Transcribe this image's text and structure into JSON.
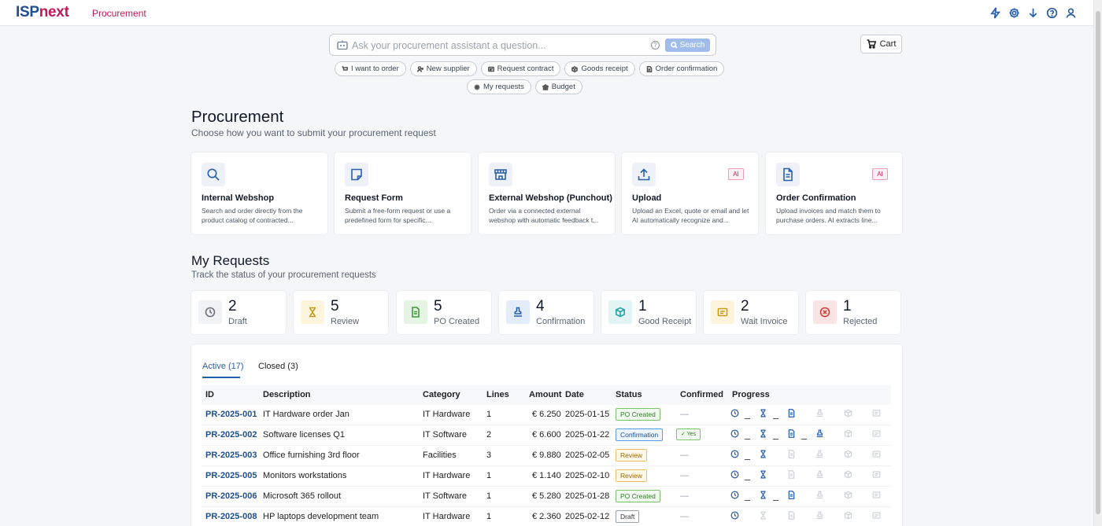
{
  "app": {
    "logo_a": "ISP",
    "logo_b": "next",
    "module": "Procurement"
  },
  "top_icons": [
    "lightning-icon",
    "gear-icon",
    "download-icon",
    "help-icon",
    "user-icon"
  ],
  "search": {
    "placeholder": "Ask your procurement assistant a question...",
    "button": "Search"
  },
  "cart": {
    "label": "Cart"
  },
  "quick_actions": [
    "I want to order",
    "New supplier",
    "Request contract",
    "Goods receipt",
    "Order confirmation",
    "My requests",
    "Budget"
  ],
  "page": {
    "title": "Procurement",
    "subtitle": "Choose how you want to submit your procurement request"
  },
  "options": [
    {
      "title": "Internal Webshop",
      "desc": "Search and order directly from the product catalog of contracted...",
      "icon": "search-icon",
      "ai": ""
    },
    {
      "title": "Request Form",
      "desc": "Submit a free-form request or use a predefined form for specific...",
      "icon": "form-icon",
      "ai": ""
    },
    {
      "title": "External Webshop (Punchout)",
      "desc": "Order via a connected external webshop with automatic feedback t...",
      "icon": "store-icon",
      "ai": ""
    },
    {
      "title": "Upload",
      "desc": "Upload an Excel, quote or email and let AI automatically recognize and...",
      "icon": "upload-icon",
      "ai": "AI"
    },
    {
      "title": "Order Confirmation",
      "desc": "Upload invoices and match them to purchase orders. AI extracts line...",
      "icon": "document-icon",
      "ai": "AI"
    }
  ],
  "requests": {
    "title": "My Requests",
    "subtitle": "Track the status of your procurement requests"
  },
  "stats": [
    {
      "value": "2",
      "label": "Draft",
      "icon": "clock-icon",
      "color": "#6b7280",
      "bg": "#f1f2f4"
    },
    {
      "value": "5",
      "label": "Review",
      "icon": "hourglass-icon",
      "color": "#c99a1a",
      "bg": "#fdf4dc"
    },
    {
      "value": "5",
      "label": "PO Created",
      "icon": "document-icon",
      "color": "#3b9b3b",
      "bg": "#e6f4e4"
    },
    {
      "value": "4",
      "label": "Confirmation",
      "icon": "stamp-icon",
      "color": "#2a5ea8",
      "bg": "#e3edf9"
    },
    {
      "value": "1",
      "label": "Good Receipt",
      "icon": "box-icon",
      "color": "#2aa5a5",
      "bg": "#e2f4f4"
    },
    {
      "value": "2",
      "label": "Wait Invoice",
      "icon": "invoice-icon",
      "color": "#c99a1a",
      "bg": "#fdf4dc"
    },
    {
      "value": "1",
      "label": "Rejected",
      "icon": "x-circle-icon",
      "color": "#d23b3b",
      "bg": "#fbe4e4"
    }
  ],
  "tabs": {
    "active": "Active (17)",
    "closed": "Closed (3)"
  },
  "columns": [
    "ID",
    "Description",
    "Category",
    "Lines",
    "Amount",
    "Date",
    "Status",
    "Confirmed",
    "Progress"
  ],
  "rows": [
    {
      "id": "PR-2025-001",
      "desc": "IT Hardware order Jan",
      "cat": "IT Hardware",
      "lines": "1",
      "amount": "€ 6.250",
      "date": "2025-01-15",
      "status": "PO Created",
      "status_type": "po",
      "confirmed": "—",
      "progress": 3
    },
    {
      "id": "PR-2025-002",
      "desc": "Software licenses Q1",
      "cat": "IT Software",
      "lines": "2",
      "amount": "€ 6.600",
      "date": "2025-01-22",
      "status": "Confirmation",
      "status_type": "conf",
      "confirmed": "Yes",
      "progress": 4
    },
    {
      "id": "PR-2025-003",
      "desc": "Office furnishing 3rd floor",
      "cat": "Facilities",
      "lines": "3",
      "amount": "€ 9.880",
      "date": "2025-02-05",
      "status": "Review",
      "status_type": "rev",
      "confirmed": "—",
      "progress": 2
    },
    {
      "id": "PR-2025-005",
      "desc": "Monitors workstations",
      "cat": "IT Hardware",
      "lines": "1",
      "amount": "€ 1.140",
      "date": "2025-02-10",
      "status": "Review",
      "status_type": "rev",
      "confirmed": "—",
      "progress": 2
    },
    {
      "id": "PR-2025-006",
      "desc": "Microsoft 365 rollout",
      "cat": "IT Software",
      "lines": "1",
      "amount": "€ 5.280",
      "date": "2025-01-28",
      "status": "PO Created",
      "status_type": "po",
      "confirmed": "—",
      "progress": 3
    },
    {
      "id": "PR-2025-008",
      "desc": "HP laptops development team",
      "cat": "IT Hardware",
      "lines": "1",
      "amount": "€ 2.360",
      "date": "2025-02-12",
      "status": "Draft",
      "status_type": "draft",
      "confirmed": "—",
      "progress": 1
    }
  ]
}
